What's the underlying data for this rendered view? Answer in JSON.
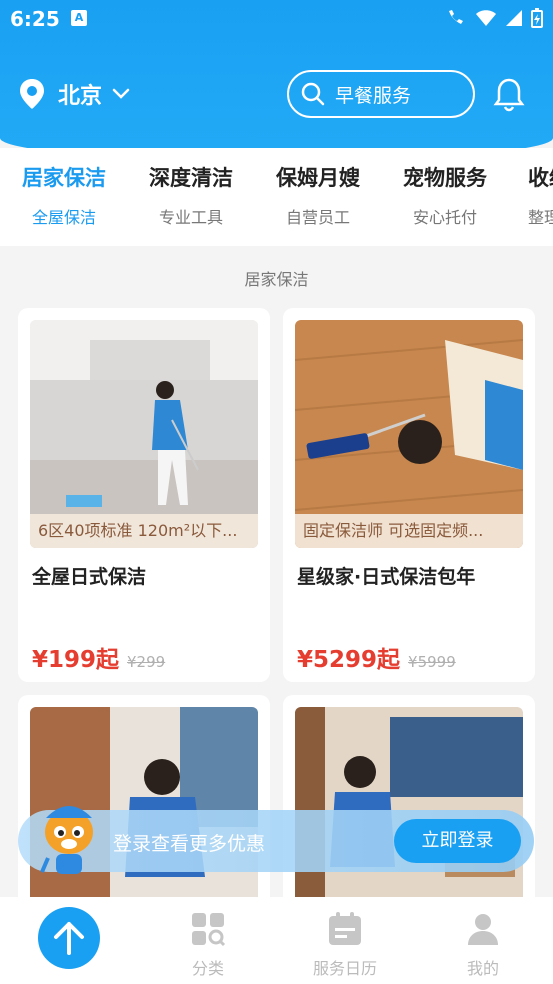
{
  "status": {
    "time": "6:25",
    "a_icon": "A"
  },
  "header": {
    "city": "北京",
    "search_placeholder": "早餐服务"
  },
  "tabs": [
    {
      "title": "居家保洁",
      "sub": "全屋保洁"
    },
    {
      "title": "深度清洁",
      "sub": "专业工具"
    },
    {
      "title": "保姆月嫂",
      "sub": "自营员工"
    },
    {
      "title": "宠物服务",
      "sub": "安心托付"
    },
    {
      "title": "收纳",
      "sub": "整理"
    }
  ],
  "section_title": "居家保洁",
  "cards": [
    {
      "caption": "6区40项标准 120m²以下...",
      "title": "全屋日式保洁",
      "price": "¥199起",
      "old_price": "¥299"
    },
    {
      "caption": "固定保洁师 可选固定频...",
      "title": "星级家·日式保洁包年",
      "price": "¥5299起",
      "old_price": "¥5999"
    }
  ],
  "login": {
    "text": "登录查看更多优惠",
    "button": "立即登录"
  },
  "nav": [
    {
      "label": "分类"
    },
    {
      "label": "服务日历"
    },
    {
      "label": "我的"
    }
  ],
  "colors": {
    "brand": "#1aa0f2",
    "price": "#e53d2f"
  }
}
